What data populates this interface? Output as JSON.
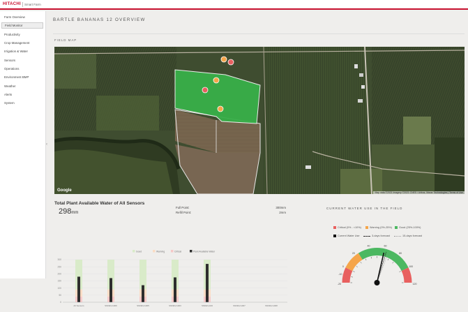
{
  "header": {
    "logo": "HITACHI",
    "product": "Smart Farm"
  },
  "sidebar": {
    "items": [
      {
        "label": "Farm Overview"
      },
      {
        "label": "Field Monitor",
        "active": true
      },
      {
        "label": "Productivity"
      },
      {
        "label": "Crop Management"
      },
      {
        "label": "Irrigation & Water"
      },
      {
        "label": "Sensors"
      },
      {
        "label": "Operations"
      },
      {
        "label": "Environment BMP"
      },
      {
        "label": "Weather"
      },
      {
        "label": "Alerts"
      },
      {
        "label": "System"
      }
    ],
    "collapse_icon": "chevron-left-icon"
  },
  "page": {
    "title": "BARTLE BANANAS 12 OVERVIEW",
    "map_label": "FIELD MAP"
  },
  "map": {
    "google_label": "Google",
    "attribution": "Map data ©2021 Imagery ©2021 CNES / Airbus, Maxar Technologies | Terms of Use"
  },
  "paw": {
    "title": "Total Plant Available Water of All Sensors",
    "value": "298",
    "unit": "mm",
    "full_point_label": "Full Point:",
    "full_point_value": "300mm",
    "refill_point_label": "Refill Point:",
    "refill_point_value": "2mm"
  },
  "current_water": {
    "title": "CURRENT WATER USE IN THE FIELD",
    "legend": [
      {
        "label": "Critical (0% - <10%)",
        "color": "#e8605f"
      },
      {
        "label": "Warning (0%-25%)",
        "color": "#f5a54a"
      },
      {
        "label": "Good (25%-100%)",
        "color": "#4cb861"
      },
      {
        "label": "Current Water Use",
        "color": "#111111"
      },
      {
        "label": "3-days forecast",
        "color": "#333333"
      },
      {
        "label": "15-days forecast",
        "color": "#999999"
      }
    ]
  },
  "chart_data": [
    {
      "type": "bar",
      "title": "",
      "legend": [
        "Good",
        "Warning",
        "Critical",
        "Plant Available Water"
      ],
      "colors": {
        "good": "#d9ebc9",
        "warning": "#fbdcc4",
        "critical": "#f6c9c8",
        "paw": "#2e2e2e"
      },
      "categories": [
        "All Sensors",
        "SNDEV-k009",
        "SNDEV-k005",
        "SNDEV-k003",
        "SNDEV-k00",
        "SNDEV-k007",
        "SNDEV-k008"
      ],
      "ylim": [
        0,
        300
      ],
      "yticks": [
        "300",
        "250",
        "200",
        "150",
        "100",
        "50",
        "0"
      ],
      "series": [
        {
          "name": "Plant Available Water",
          "values": [
            180,
            170,
            120,
            175,
            270,
            null,
            null
          ]
        }
      ]
    },
    {
      "type": "gauge",
      "min": -20,
      "max": 120,
      "ticks": [
        "-20",
        "-10",
        "0",
        "10",
        "20",
        "30",
        "40",
        "50",
        "60",
        "70",
        "80",
        "100",
        "120"
      ],
      "bands": [
        {
          "from": -20,
          "to": 0,
          "color": "#e8605f"
        },
        {
          "from": 0,
          "to": 25,
          "color": "#f5a54a"
        },
        {
          "from": 25,
          "to": 100,
          "color": "#4cb861"
        },
        {
          "from": 100,
          "to": 120,
          "color": "#e8605f"
        }
      ],
      "current": 60,
      "forecast_3d": 63,
      "forecast_15d": 66
    }
  ]
}
